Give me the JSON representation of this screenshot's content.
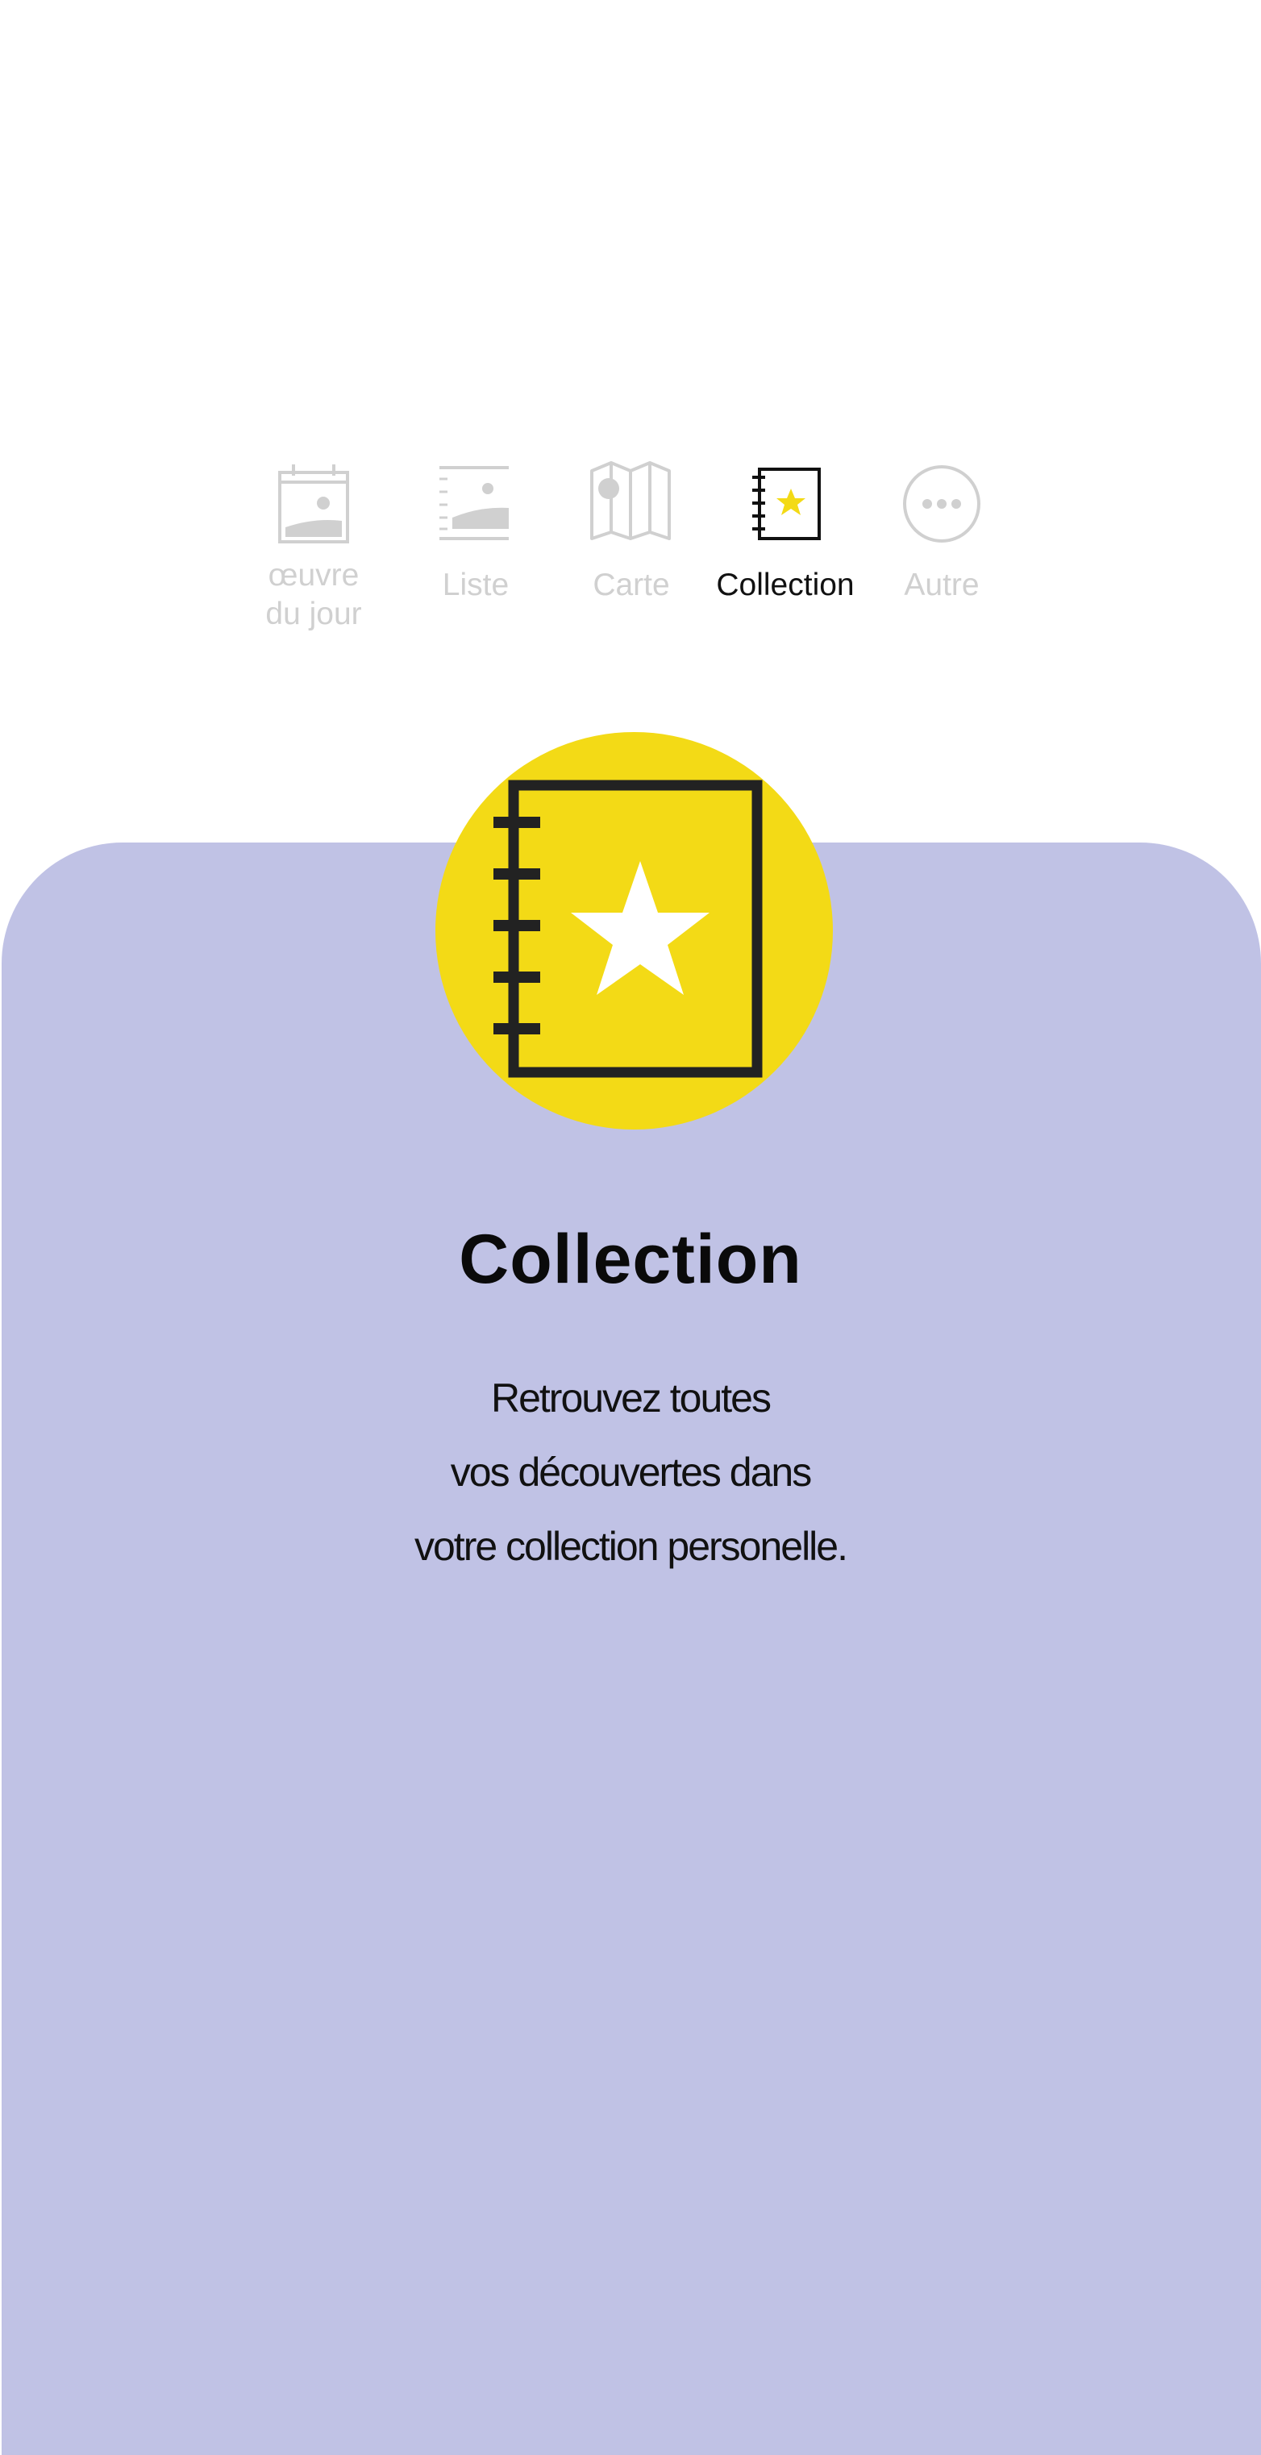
{
  "tabs": [
    {
      "id": "oeuvre",
      "label": "œuvre\ndu jour",
      "icon": "daily-artwork-calendar-icon",
      "active": false
    },
    {
      "id": "liste",
      "label": "Liste",
      "icon": "list-image-icon",
      "active": false
    },
    {
      "id": "carte",
      "label": "Carte",
      "icon": "folded-map-icon",
      "active": false
    },
    {
      "id": "collection",
      "label": "Collection",
      "icon": "notebook-star-icon",
      "active": true
    },
    {
      "id": "autre",
      "label": "Autre",
      "icon": "more-dots-icon",
      "active": false
    }
  ],
  "colors": {
    "inactive": "#d0d0d0",
    "active": "#111111",
    "panel": "#c0c2e5",
    "accent_yellow": "#f3da16",
    "ink": "#222222"
  },
  "hero": {
    "icon": "notebook-star-icon",
    "title": "Collection",
    "description": [
      "Retrouvez toutes",
      "vos découvertes dans",
      "votre collection  personelle."
    ]
  }
}
